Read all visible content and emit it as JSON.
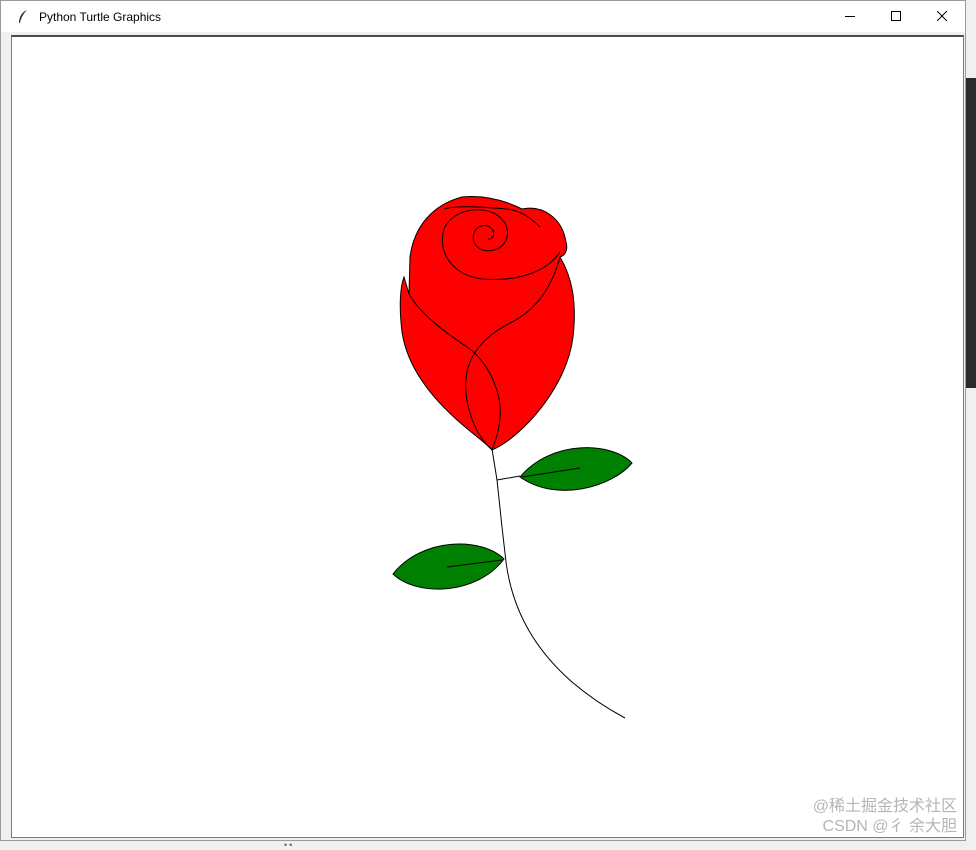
{
  "window": {
    "title": "Python Turtle Graphics",
    "icons": {
      "app": "feather-icon",
      "minimize": "minimize-icon",
      "maximize": "maximize-icon",
      "close": "close-icon"
    }
  },
  "canvas": {
    "background": "#ffffff",
    "drawing": {
      "subject": "rose",
      "colors": {
        "petals": "#ff0000",
        "leaves": "#008000",
        "outline": "#000000"
      }
    }
  },
  "watermark": {
    "line1": "@稀土掘金技术社区",
    "line2": "CSDN @彳 余大胆"
  }
}
